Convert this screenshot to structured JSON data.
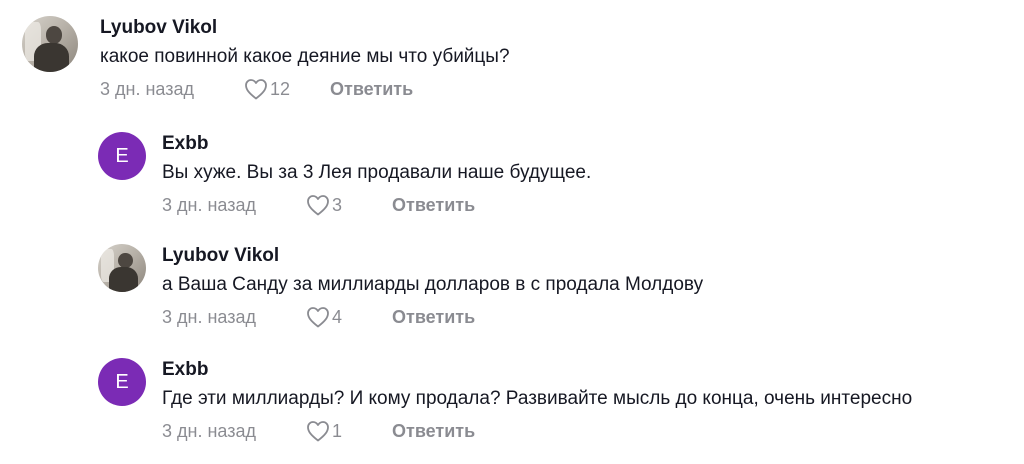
{
  "comments": [
    {
      "avatar_type": "photo",
      "avatar_letter": "",
      "username": "Lyubov Vikol",
      "text": "какое повинной какое деяние мы что убийцы?",
      "time": "3 дн. назад",
      "likes": "12",
      "reply_label": "Ответить"
    },
    {
      "avatar_type": "letter",
      "avatar_letter": "E",
      "username": "Exbb",
      "text": "Вы хуже. Вы за 3 Лея продавали наше будущее.",
      "time": "3 дн. назад",
      "likes": "3",
      "reply_label": "Ответить"
    },
    {
      "avatar_type": "photo",
      "avatar_letter": "",
      "username": "Lyubov Vikol",
      "text": "а Ваша Санду за миллиарды долларов в с продала Молдову",
      "time": "3 дн. назад",
      "likes": "4",
      "reply_label": "Ответить"
    },
    {
      "avatar_type": "letter",
      "avatar_letter": "E",
      "username": "Exbb",
      "text": "Где эти миллиарды? И кому продала? Развивайте мысль до конца, очень интересно",
      "time": "3 дн. назад",
      "likes": "1",
      "reply_label": "Ответить"
    }
  ],
  "colors": {
    "letter_avatar_bg": "#7b2bb5",
    "text": "#161823",
    "muted": "#8a8b91"
  },
  "icons": {
    "like": "heart-outline-icon"
  }
}
